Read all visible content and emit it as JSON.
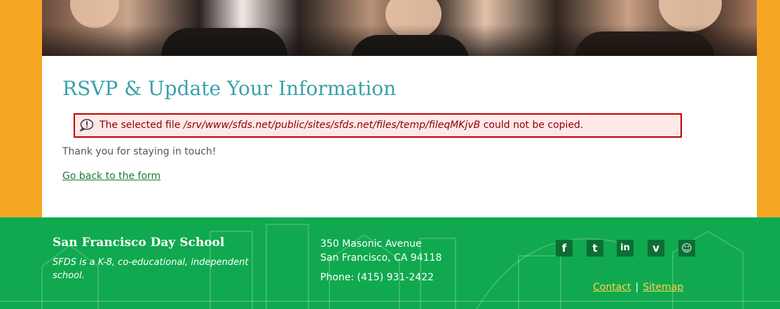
{
  "hero": {
    "icon": "graduation-photo"
  },
  "main": {
    "title": "RSVP & Update Your Information",
    "error": {
      "prefix": "The selected file",
      "path": "/srv/www/sfds.net/public/sites/sfds.net/files/temp/fileqMKjvB",
      "suffix": "could not be copied.",
      "icon": "exclamation-bubble-icon",
      "border_color": "#c00000",
      "background": "#ffe8e8"
    },
    "thanks": "Thank you for staying in touch!",
    "back_link": "Go back to the form"
  },
  "footer": {
    "school_name": "San Francisco Day School",
    "description": "SFDS is a K-8, co-educational, independent school.",
    "address_line1": "350 Masonic Avenue",
    "address_line2": "San Francisco, CA 94118",
    "phone": "Phone: (415) 931-2422",
    "social": [
      {
        "name": "facebook",
        "glyph": "f"
      },
      {
        "name": "twitter",
        "glyph": "t"
      },
      {
        "name": "linkedin",
        "glyph": "in"
      },
      {
        "name": "vimeo",
        "glyph": "v"
      },
      {
        "name": "smugmug",
        "glyph": "☺"
      }
    ],
    "links": {
      "contact": "Contact",
      "separator": "|",
      "sitemap": "Sitemap"
    }
  },
  "colors": {
    "page_bg": "#f5a623",
    "title": "#3aa1a9",
    "footer_bg": "#10a94f",
    "link": "#1a7a3a",
    "footer_link": "#ffd34d"
  }
}
